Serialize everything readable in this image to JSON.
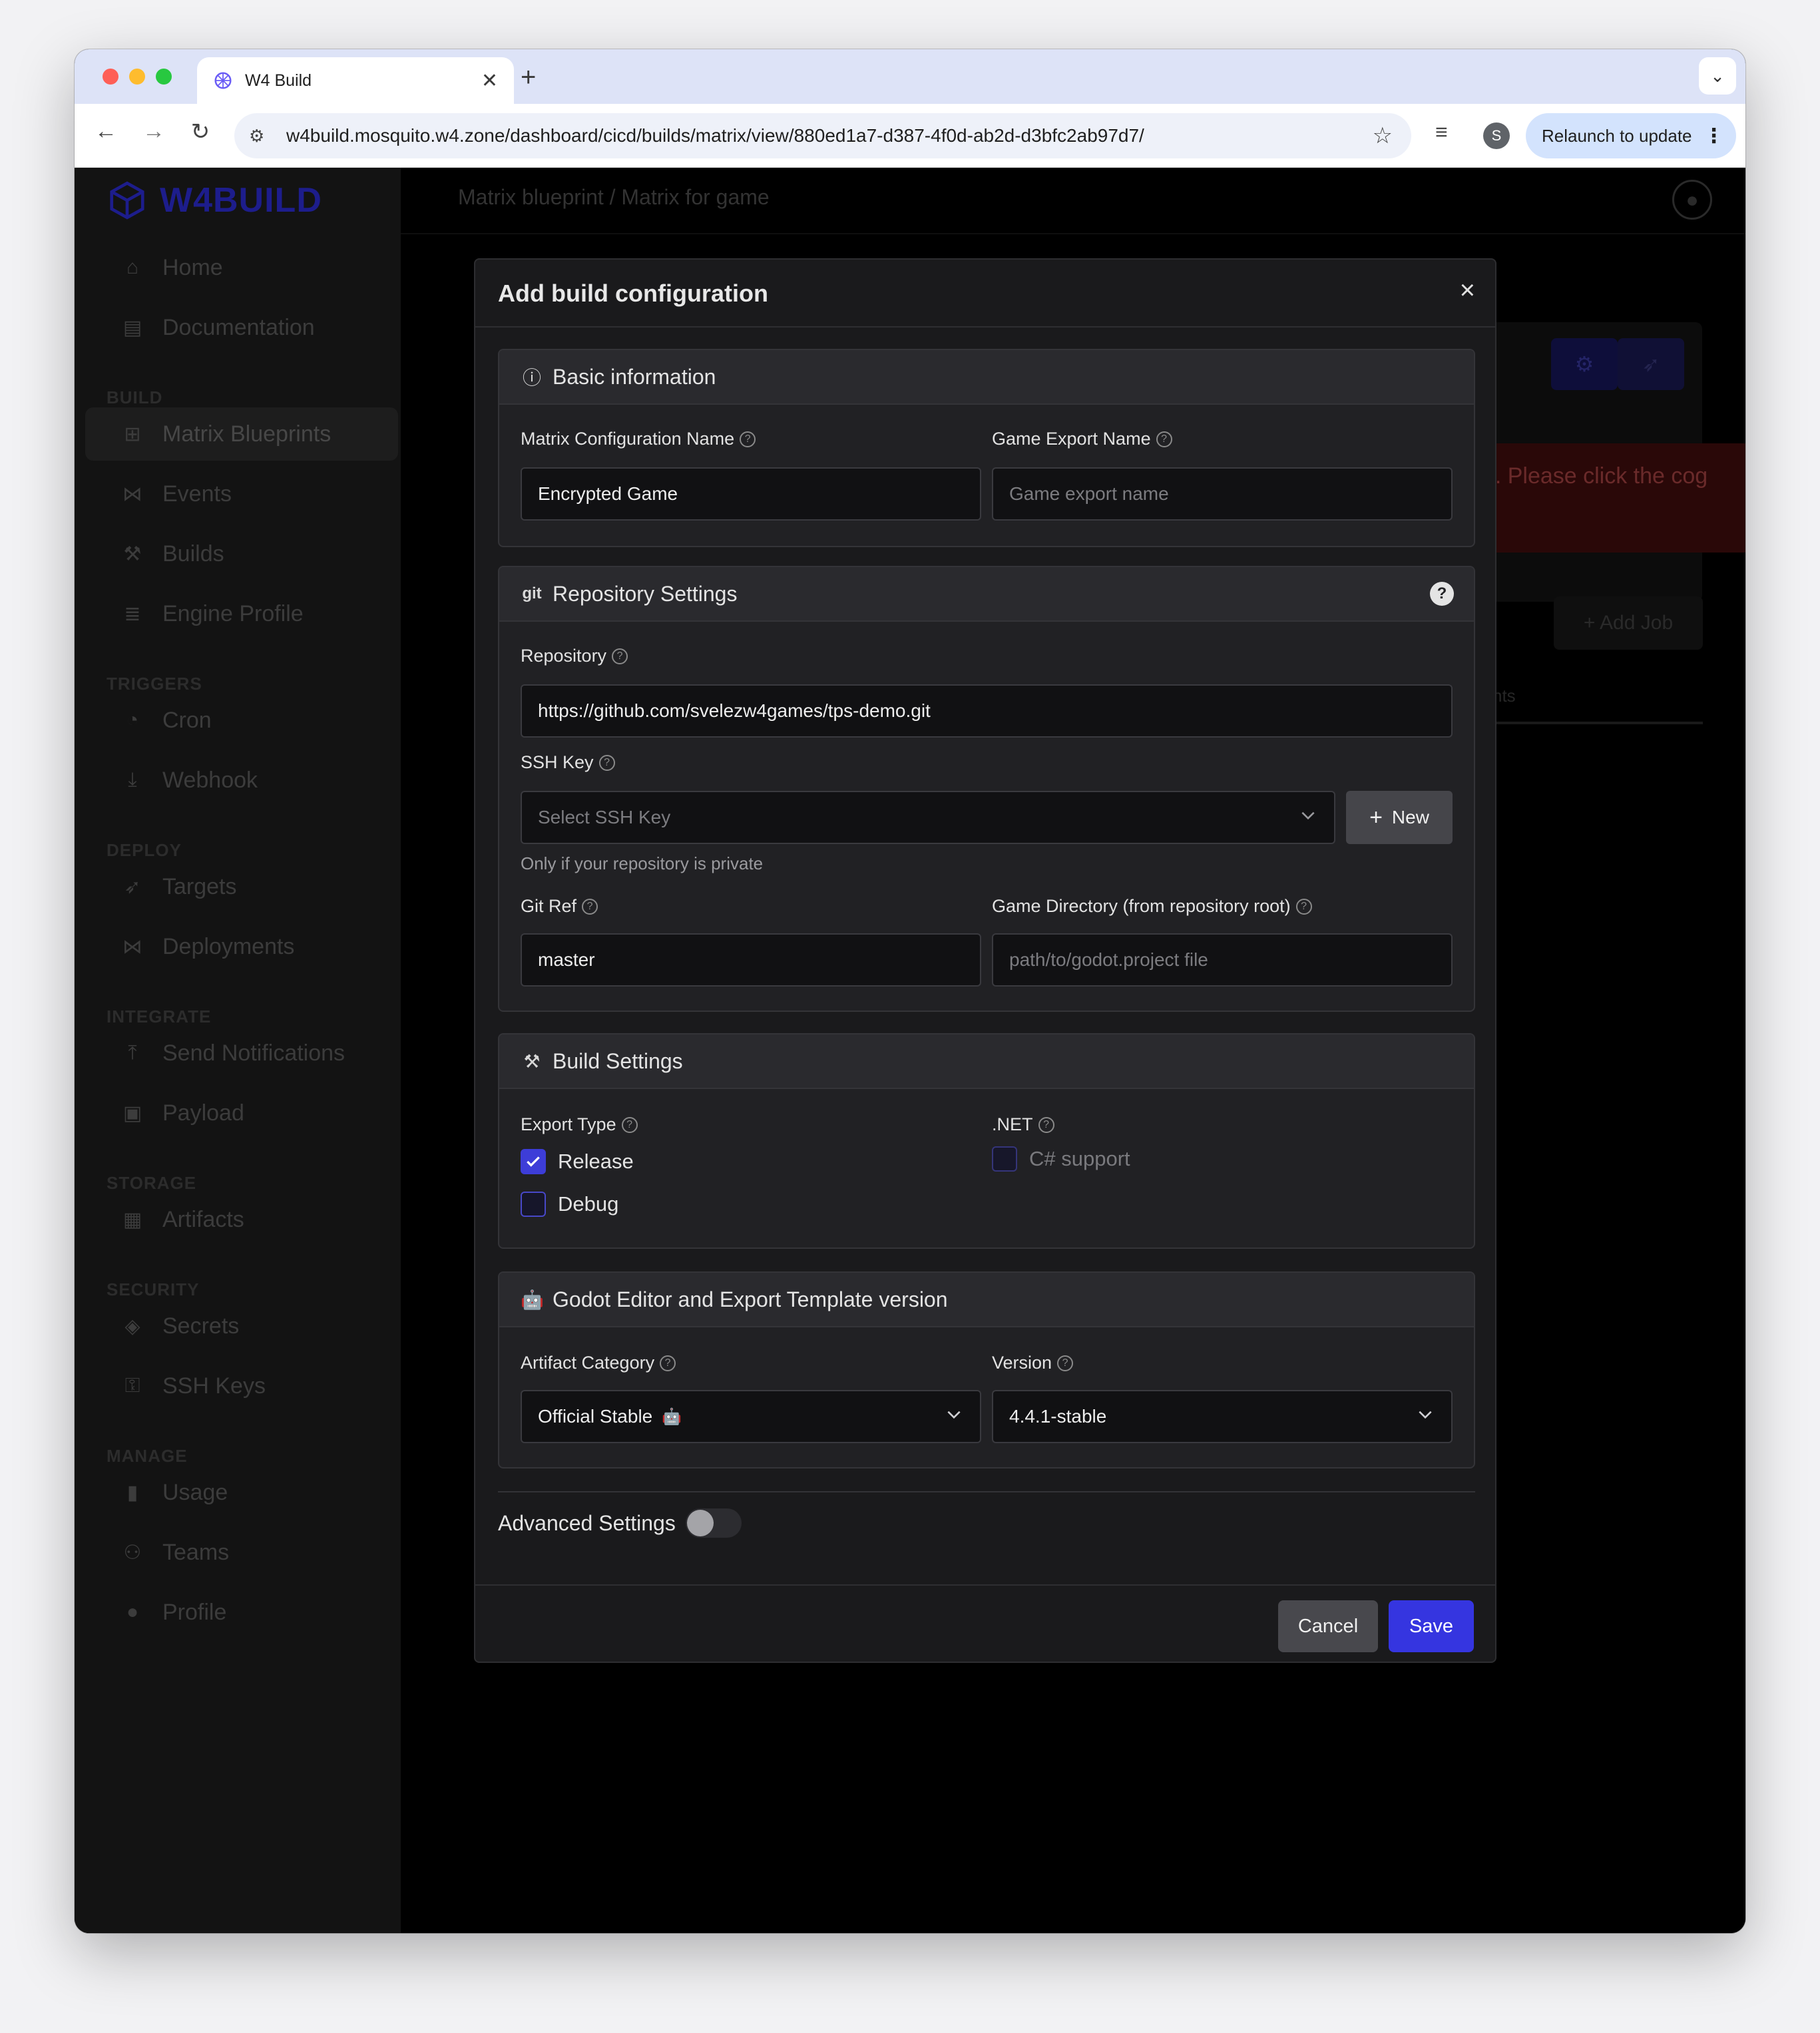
{
  "browser": {
    "tab_title": "W4 Build",
    "tab_favicon": "w4-logo-icon",
    "url": "w4build.mosquito.w4.zone/dashboard/cicd/builds/matrix/view/880ed1a7-d387-4f0d-ab2d-d3bfc2ab97d7/",
    "profile_initial": "S",
    "relaunch_label": "Relaunch to update"
  },
  "sidebar": {
    "logo_text": "W4BUILD",
    "items_top": [
      {
        "label": "Home",
        "icon": "home-icon"
      },
      {
        "label": "Documentation",
        "icon": "book-icon"
      }
    ],
    "sections": [
      {
        "title": "BUILD",
        "items": [
          {
            "label": "Matrix Blueprints",
            "icon": "sitemap-icon",
            "active": true
          },
          {
            "label": "Events",
            "icon": "network-icon"
          },
          {
            "label": "Builds",
            "icon": "hammer-icon"
          },
          {
            "label": "Engine Profile",
            "icon": "list-icon"
          }
        ]
      },
      {
        "title": "TRIGGERS",
        "items": [
          {
            "label": "Cron",
            "icon": "stopwatch-icon"
          },
          {
            "label": "Webhook",
            "icon": "download-icon"
          }
        ]
      },
      {
        "title": "DEPLOY",
        "items": [
          {
            "label": "Targets",
            "icon": "rocket-icon"
          },
          {
            "label": "Deployments",
            "icon": "network-icon"
          }
        ]
      },
      {
        "title": "INTEGRATE",
        "items": [
          {
            "label": "Send Notifications",
            "icon": "upload-icon"
          },
          {
            "label": "Payload",
            "icon": "save-icon"
          }
        ]
      },
      {
        "title": "STORAGE",
        "items": [
          {
            "label": "Artifacts",
            "icon": "archive-icon"
          }
        ]
      },
      {
        "title": "SECURITY",
        "items": [
          {
            "label": "Secrets",
            "icon": "user-secret-icon"
          },
          {
            "label": "SSH Keys",
            "icon": "key-icon"
          }
        ]
      },
      {
        "title": "MANAGE",
        "items": [
          {
            "label": "Usage",
            "icon": "bar-chart-icon"
          },
          {
            "label": "Teams",
            "icon": "users-icon"
          },
          {
            "label": "Profile",
            "icon": "user-icon"
          }
        ]
      }
    ]
  },
  "page": {
    "breadcrumb": "Matrix blueprint / Matrix for game",
    "alert_text": "ng. Please click the cog",
    "add_job_label": "Add Job",
    "tab_fragment": "nts"
  },
  "modal": {
    "title": "Add build configuration",
    "close_symbol": "×",
    "basic": {
      "title": "Basic information",
      "config_name_label": "Matrix Configuration Name",
      "config_name_value": "Encrypted Game",
      "export_name_label": "Game Export Name",
      "export_name_placeholder": "Game export name"
    },
    "repo": {
      "title": "Repository Settings",
      "git_badge": "git",
      "help_symbol": "?",
      "repository_label": "Repository",
      "repository_value": "https://github.com/svelezw4games/tps-demo.git",
      "ssh_label": "SSH Key",
      "ssh_placeholder": "Select SSH Key",
      "new_label": "New",
      "ssh_hint": "Only if your repository is private",
      "gitref_label": "Git Ref",
      "gitref_value": "master",
      "gamedir_label": "Game Directory (from repository root)",
      "gamedir_placeholder": "path/to/godot.project file"
    },
    "build": {
      "title": "Build Settings",
      "export_type_label": "Export Type",
      "release_label": "Release",
      "release_checked": true,
      "debug_label": "Debug",
      "debug_checked": false,
      "dotnet_label": ".NET",
      "csharp_label": "C# support",
      "csharp_checked": false
    },
    "godot": {
      "title": "Godot Editor and Export Template version",
      "category_label": "Artifact Category",
      "category_value": "Official Stable",
      "version_label": "Version",
      "version_value": "4.4.1-stable"
    },
    "advanced_label": "Advanced Settings",
    "advanced_enabled": false,
    "cancel_label": "Cancel",
    "save_label": "Save"
  },
  "colors": {
    "accent": "#3535e0",
    "modal_bg": "#1a1a1c",
    "panel_bg": "#212124"
  }
}
